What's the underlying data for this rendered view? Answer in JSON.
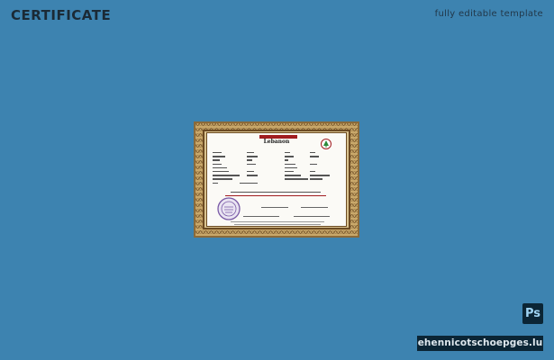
{
  "header": {
    "title": "CERTIFICATE",
    "tagline": "fully editable template"
  },
  "certificate": {
    "country": "Lebanon"
  },
  "badges": {
    "app_icon": "Ps",
    "brand": "ehennicotschoepges.lu"
  },
  "colors": {
    "background": "#3d83b0",
    "badge": "#0b2535",
    "border": "#b9955a",
    "accent_red": "#a11d21"
  }
}
